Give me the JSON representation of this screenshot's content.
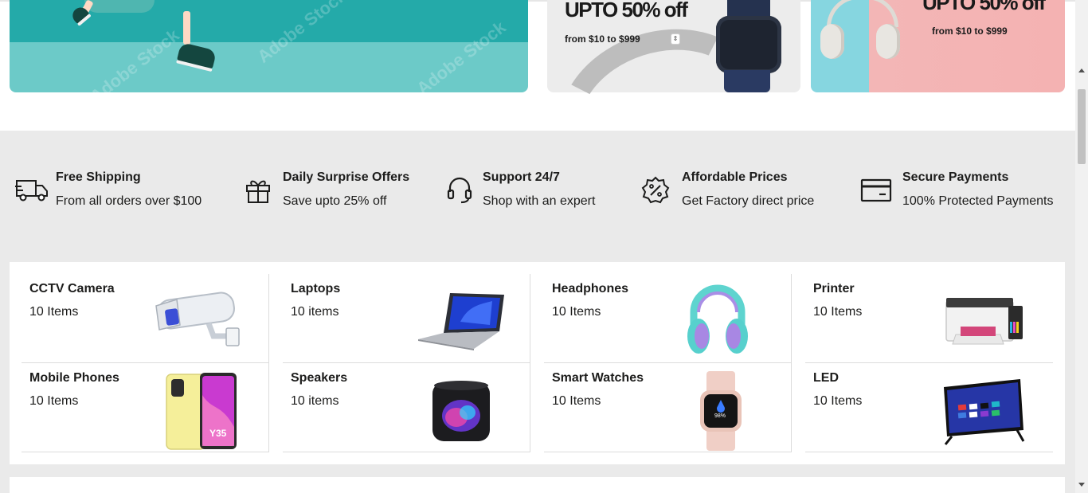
{
  "promos": {
    "watch": {
      "title": "UPTO 50% off",
      "subtitle": "from $10 to $999"
    },
    "headphones": {
      "title": "UPTO 50% off",
      "subtitle": "from $10 to $999"
    }
  },
  "features": [
    {
      "icon": "truck-icon",
      "title": "Free Shipping",
      "subtitle": "From all orders over $100"
    },
    {
      "icon": "gift-icon",
      "title": "Daily Surprise Offers",
      "subtitle": "Save upto 25% off"
    },
    {
      "icon": "headset-icon",
      "title": "Support 24/7",
      "subtitle": "Shop with an expert"
    },
    {
      "icon": "discount-badge-icon",
      "title": "Affordable Prices",
      "subtitle": "Get Factory direct price"
    },
    {
      "icon": "credit-card-icon",
      "title": "Secure Payments",
      "subtitle": "100% Protected Payments"
    }
  ],
  "categories": [
    {
      "name": "CCTV Camera",
      "count": "10 Items",
      "image": "cctv-camera-image"
    },
    {
      "name": "Laptops",
      "count": "10 items",
      "image": "laptop-image"
    },
    {
      "name": "Headphones",
      "count": "10 Items",
      "image": "headphones-image"
    },
    {
      "name": "Printer",
      "count": "10 Items",
      "image": "printer-image"
    },
    {
      "name": "Mobile Phones",
      "count": "10 Items",
      "image": "mobile-phone-image"
    },
    {
      "name": "Speakers",
      "count": "10 items",
      "image": "speaker-image"
    },
    {
      "name": "Smart Watches",
      "count": "10 Items",
      "image": "smart-watch-image"
    },
    {
      "name": "LED",
      "count": "10 Items",
      "image": "led-tv-image"
    }
  ],
  "colors": {
    "section_bg": "#eaeaea",
    "text": "#1c1c1b",
    "banner_teal": "#24aaa9",
    "banner_pink": "#f4b2b2"
  }
}
